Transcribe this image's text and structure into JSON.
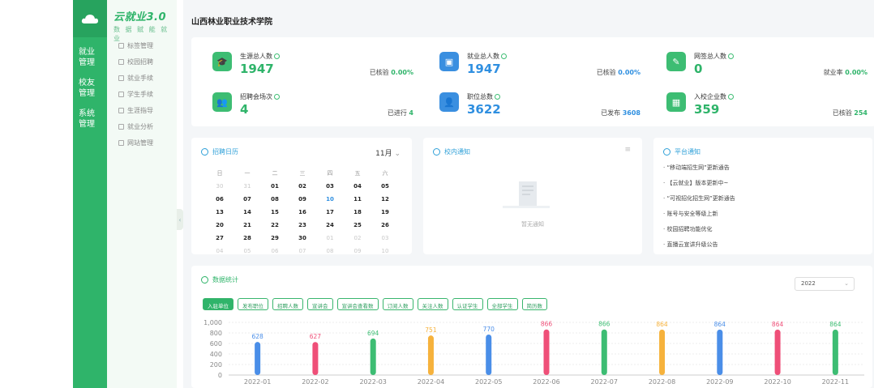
{
  "sidebar": {
    "rail_items": [
      "就业\n管理",
      "校友\n管理",
      "系统\n管理"
    ],
    "brand_title": "云就业3.0",
    "brand_sub": "数 据 赋 能 就 业",
    "menu_items": [
      "标签管理",
      "校园招聘",
      "就业手续",
      "学生手续",
      "生涯指导",
      "就业分析",
      "网站管理"
    ]
  },
  "header": {
    "school_name": "山西林业职业技术学院"
  },
  "stats": [
    {
      "label": "生源总人数",
      "value": "1947",
      "right_label": "已核验",
      "right_value": "0.00%",
      "icon": "graduate-icon",
      "color": "#3dbd73",
      "value_color": "#2fb46a"
    },
    {
      "label": "就业总人数",
      "value": "1947",
      "right_label": "已核验",
      "right_value": "0.00%",
      "icon": "briefcase-icon",
      "color": "#3a8fe0",
      "value_color": "#2f8fe0"
    },
    {
      "label": "网签总人数",
      "value": "0",
      "right_label": "就业率",
      "right_value": "0.00%",
      "icon": "contract-icon",
      "color": "#3dbd73",
      "value_color": "#2fb46a"
    },
    {
      "label": "招聘会场次",
      "value": "4",
      "right_label": "已进行",
      "right_value": "4",
      "icon": "people-icon",
      "color": "#3dbd73",
      "value_color": "#2fb46a"
    },
    {
      "label": "职位总数",
      "value": "3622",
      "right_label": "已发布",
      "right_value": "3608",
      "icon": "user-icon",
      "color": "#3a8fe0",
      "value_color": "#2f8fe0"
    },
    {
      "label": "入校企业数",
      "value": "359",
      "right_label": "已核验",
      "right_value": "254",
      "icon": "building-icon",
      "color": "#3dbd73",
      "value_color": "#2fb46a"
    }
  ],
  "calendar": {
    "title": "招聘日历",
    "month": "11月",
    "weekdays": [
      "日",
      "一",
      "二",
      "三",
      "四",
      "五",
      "六"
    ],
    "weeks": [
      [
        "30",
        "31",
        "01",
        "02",
        "03",
        "04",
        "05"
      ],
      [
        "06",
        "07",
        "08",
        "09",
        "10",
        "11",
        "12"
      ],
      [
        "13",
        "14",
        "15",
        "16",
        "17",
        "18",
        "19"
      ],
      [
        "20",
        "21",
        "22",
        "23",
        "24",
        "25",
        "26"
      ],
      [
        "27",
        "28",
        "29",
        "30",
        "01",
        "02",
        "03"
      ],
      [
        "04",
        "05",
        "06",
        "07",
        "08",
        "09",
        "10"
      ]
    ]
  },
  "notices": {
    "title": "校内通知",
    "empty_text": "暂无通知"
  },
  "platform": {
    "title": "平台通知",
    "items": [
      "“移动端招生网”更新通告",
      "【云就业】版本更新中~",
      "“可视招化招生网”更新通告",
      "账号与安全等级上新",
      "校园招聘功能优化",
      "直播云宣讲升级公告"
    ]
  },
  "chart_panel": {
    "title": "数据统计",
    "year": "2022",
    "chips": [
      "入驻单位",
      "发布职位",
      "招聘人数",
      "宣讲会",
      "宣讲会查看数",
      "订阅人数",
      "关注人数",
      "认证学生",
      "全部学生",
      "简历数"
    ]
  },
  "chart_data": {
    "type": "bar",
    "categories": [
      "2022-01",
      "2022-02",
      "2022-03",
      "2022-04",
      "2022-05",
      "2022-06",
      "2022-07",
      "2022-08",
      "2022-09",
      "2022-10",
      "2022-11"
    ],
    "values": [
      628,
      627,
      694,
      751,
      770,
      866,
      866,
      864,
      864,
      864,
      864
    ],
    "yticks": [
      0,
      200,
      400,
      600,
      800,
      "1,000"
    ],
    "ylim": [
      0,
      1000
    ],
    "colors": [
      "#4a8ee8",
      "#ef4f78",
      "#3dbd73",
      "#f6b23c",
      "#4a8ee8",
      "#ef4f78",
      "#3dbd73",
      "#f6b23c",
      "#4a8ee8",
      "#ef4f78",
      "#3dbd73"
    ]
  }
}
